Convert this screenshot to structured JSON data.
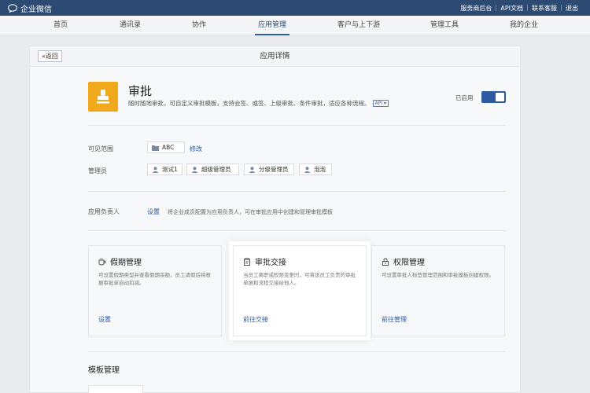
{
  "topbar": {
    "logo_text": "企业微信",
    "links": [
      "服务商后台",
      "API文档",
      "联系客服",
      "退出"
    ]
  },
  "nav": {
    "items": [
      "首页",
      "通讯录",
      "协作",
      "应用管理",
      "客户与上下游",
      "管理工具",
      "我的企业"
    ],
    "active": "应用管理"
  },
  "panel": {
    "back_label": "«返回",
    "title": "应用详情"
  },
  "app": {
    "name": "审批",
    "description": "随时随地审批，可自定义审批模板，支持会签、或签、上级审批、条件审批，适应各种流程。",
    "api_badge": "API ▾",
    "status_label": "已启用",
    "enabled": true,
    "icon_color": "#f0a81c"
  },
  "visibility": {
    "label": "可见范围",
    "value": "ABC",
    "edit_link": "修改"
  },
  "admins": {
    "label": "管理员",
    "items": [
      "测试1",
      "超级管理员",
      "分级管理员",
      "泡泡"
    ]
  },
  "owner": {
    "label": "应用负责人",
    "set_link": "设置",
    "hint": "将企业成员配置为应用负责人，可在审批应用中创建和管理审批模板"
  },
  "cards": [
    {
      "title": "假期管理",
      "icon": "cup-icon",
      "description": "可设置假期类型并查看假期余额，员工请假后将根据审批单自动扣减。",
      "action": "设置"
    },
    {
      "title": "审批交接",
      "icon": "clipboard-icon",
      "description": "当员工离职或权限变更时，可将该员工负责的审批单据和流程交接给他人。",
      "action": "前往交接"
    },
    {
      "title": "权限管理",
      "icon": "lock-icon",
      "description": "可设置审批人标签管理范围和审批模板创建权限。",
      "action": "前往管理"
    }
  ],
  "templates": {
    "title": "模板管理"
  },
  "colors": {
    "topbar": "#2d4a73",
    "accent": "#2d5aa0",
    "app_icon": "#f0a81c"
  }
}
